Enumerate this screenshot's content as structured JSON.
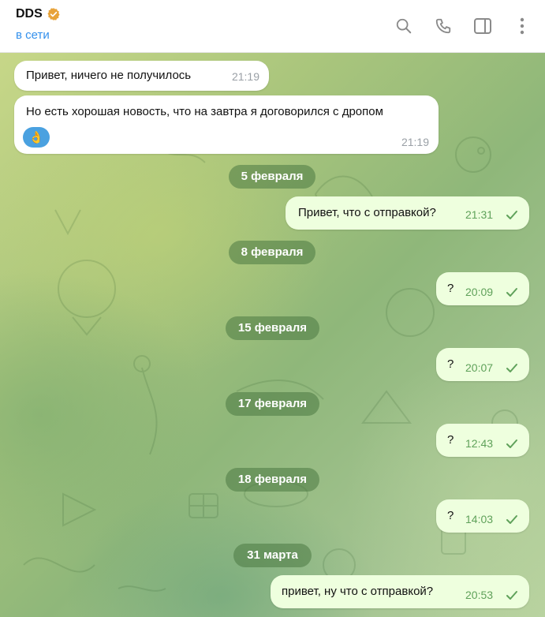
{
  "header": {
    "title": "DDS",
    "status": "в сети",
    "icons": [
      "search-icon",
      "phone-icon",
      "sidebar-toggle-icon",
      "more-vertical-icon"
    ]
  },
  "messages": [
    {
      "id": "m1",
      "direction": "in",
      "text": "Привет, ничего не получилось",
      "time": "21:19"
    },
    {
      "id": "m2",
      "direction": "in",
      "text": "Но есть хорошая новость, что на завтра я договорился с дропом",
      "time": "21:19",
      "emoji": "👌"
    },
    {
      "id": "d1",
      "type": "date",
      "text": "5 февраля"
    },
    {
      "id": "m3",
      "direction": "out",
      "text": "Привет, что с отправкой?",
      "time": "21:31"
    },
    {
      "id": "d2",
      "type": "date",
      "text": "8 февраля"
    },
    {
      "id": "m4",
      "direction": "out",
      "text": "?",
      "time": "20:09"
    },
    {
      "id": "d3",
      "type": "date",
      "text": "15 февраля"
    },
    {
      "id": "m5",
      "direction": "out",
      "text": "?",
      "time": "20:07"
    },
    {
      "id": "d4",
      "type": "date",
      "text": "17 февраля"
    },
    {
      "id": "m6",
      "direction": "out",
      "text": "?",
      "time": "12:43"
    },
    {
      "id": "d5",
      "type": "date",
      "text": "18 февраля"
    },
    {
      "id": "m7",
      "direction": "out",
      "text": "?",
      "time": "14:03"
    },
    {
      "id": "d6",
      "type": "date",
      "text": "31 марта"
    },
    {
      "id": "m8",
      "direction": "out",
      "text": "привет, ну что с отправкой?",
      "time": "20:53"
    }
  ],
  "colors": {
    "accent": "#3390ec",
    "outgoing_bubble": "#eeffde",
    "incoming_bubble": "#ffffff",
    "read_check": "#5fa15a",
    "verified_badge": "#e8a33a"
  }
}
